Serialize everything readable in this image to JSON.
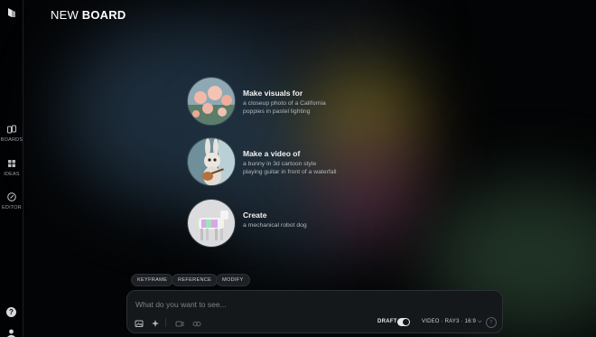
{
  "header": {
    "title_light": "NEW",
    "title_bold": "BOARD"
  },
  "sidebar": {
    "items": [
      {
        "label": "BOARDS",
        "icon": "boards-icon"
      },
      {
        "label": "IDEAS",
        "icon": "ideas-icon"
      },
      {
        "label": "EDITOR",
        "icon": "editor-icon"
      }
    ],
    "help": "?"
  },
  "suggestions": [
    {
      "title": "Make visuals for",
      "desc_line1": "a closeup photo of a California",
      "desc_line2": "poppies in pastel lighting",
      "thumb": "poppies-image"
    },
    {
      "title": "Make a video of",
      "desc_line1": "a bunny in 3d cartoon style",
      "desc_line2": "playing guitar in front of a waterfall",
      "thumb": "bunny-guitar-image"
    },
    {
      "title": "Create",
      "desc_line1": "a mechanical robot dog",
      "desc_line2": "",
      "thumb": "robot-dog-image"
    }
  ],
  "chips": [
    "KEYFRAME",
    "REFERENCE",
    "MODIFY"
  ],
  "prompt": {
    "placeholder": "What do you want to see...",
    "draft_label": "DRAFT",
    "draft_on": true,
    "model": "VIDEO · RAY3 · 16:9"
  },
  "colors": {
    "background": "#000000",
    "panel": "#15181b",
    "text": "#e9e9e9"
  }
}
